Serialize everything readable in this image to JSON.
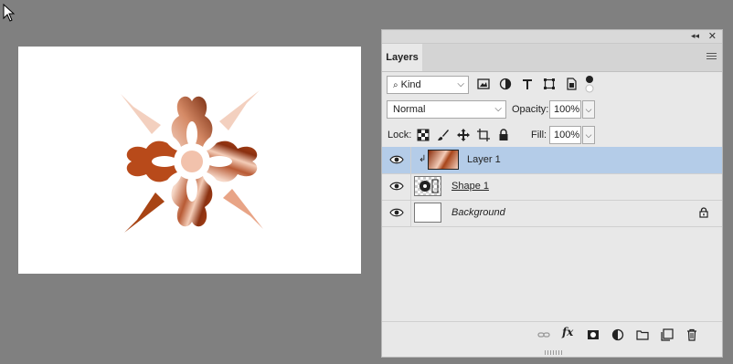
{
  "panel": {
    "collapse_glyph": "◂◂",
    "close_glyph": "✕",
    "tab": "Layers",
    "filter": {
      "label": "Kind"
    },
    "blend_mode": "Normal",
    "opacity_label": "Opacity:",
    "opacity_value": "100%",
    "lock_label": "Lock:",
    "fill_label": "Fill:",
    "fill_value": "100%"
  },
  "layers": [
    {
      "name": "Layer 1",
      "selected": true,
      "clipped": true
    },
    {
      "name": "Shape 1",
      "selected": false,
      "clipped": false
    },
    {
      "name": "Background",
      "selected": false,
      "clipped": false,
      "locked": true
    }
  ],
  "colors": {
    "workspace": "#808080",
    "panel": "#e8e8e8",
    "selection": "#b4cce8",
    "copper_dark": "#7a2a0c",
    "copper_mid": "#c65a2a",
    "copper_light": "#f6d6c6"
  }
}
